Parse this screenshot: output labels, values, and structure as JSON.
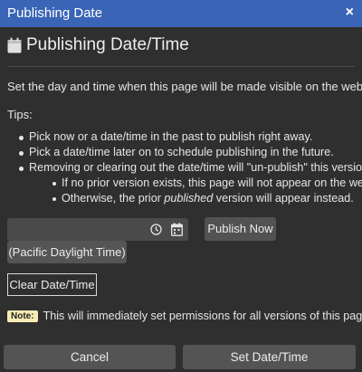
{
  "dialog": {
    "title": "Publishing Date",
    "close_glyph": "×",
    "heading": "Publishing Date/Time",
    "heading_icon": "calendar-icon",
    "intro": "Set the day and time when this page will be made visible on the web.",
    "tips_label": "Tips:",
    "tips": [
      "Pick now or a date/time in the past to publish right away.",
      "Pick a date/time later on to schedule publishing in the future.",
      "Removing or clearing out the date/time will \"un-publish\" this version."
    ],
    "subtips": [
      "If no prior version exists, this page will not appear on the web.",
      {
        "before": "Otherwise, the prior ",
        "italic": "published",
        "after": " version will appear instead."
      }
    ],
    "datetime": {
      "value": "",
      "clock_icon": "clock-icon",
      "calendar_icon": "calendar-picker-icon"
    },
    "publish_now_label": "Publish Now",
    "timezone_label": "(Pacific Daylight Time)",
    "clear_label": "Clear Date/Time",
    "note_badge": "Note:",
    "note_text": "This will immediately set permissions for all versions of this page.",
    "footer": {
      "cancel_label": "Cancel",
      "set_label": "Set Date/Time"
    },
    "colors": {
      "titlebar": "#3a65b6",
      "background": "#2f2f2f",
      "note_badge": "#f7ecb5"
    }
  }
}
